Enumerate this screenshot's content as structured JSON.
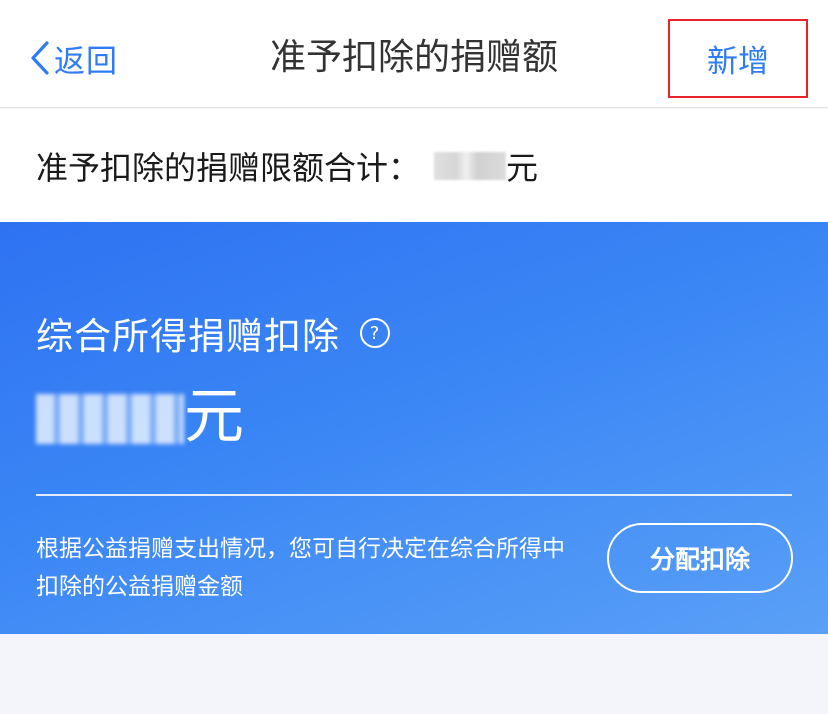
{
  "header": {
    "back_label": "返回",
    "title": "准予扣除的捐赠额",
    "add_label": "新增"
  },
  "summary": {
    "label": "准予扣除的捐赠限额合计：",
    "unit": "元"
  },
  "card": {
    "title": "综合所得捐赠扣除",
    "help_symbol": "?",
    "amount_unit": "元",
    "description": "根据公益捐赠支出情况，您可自行决定在综合所得中扣除的公益捐赠金额",
    "allocate_label": "分配扣除"
  },
  "colors": {
    "accent": "#2f7cf6",
    "highlight_border": "#e8232a",
    "card_gradient_start": "#2e72f2",
    "card_gradient_end": "#5aa0f7"
  },
  "icons": {
    "back": "chevron-left-icon",
    "help": "question-circle-icon"
  }
}
